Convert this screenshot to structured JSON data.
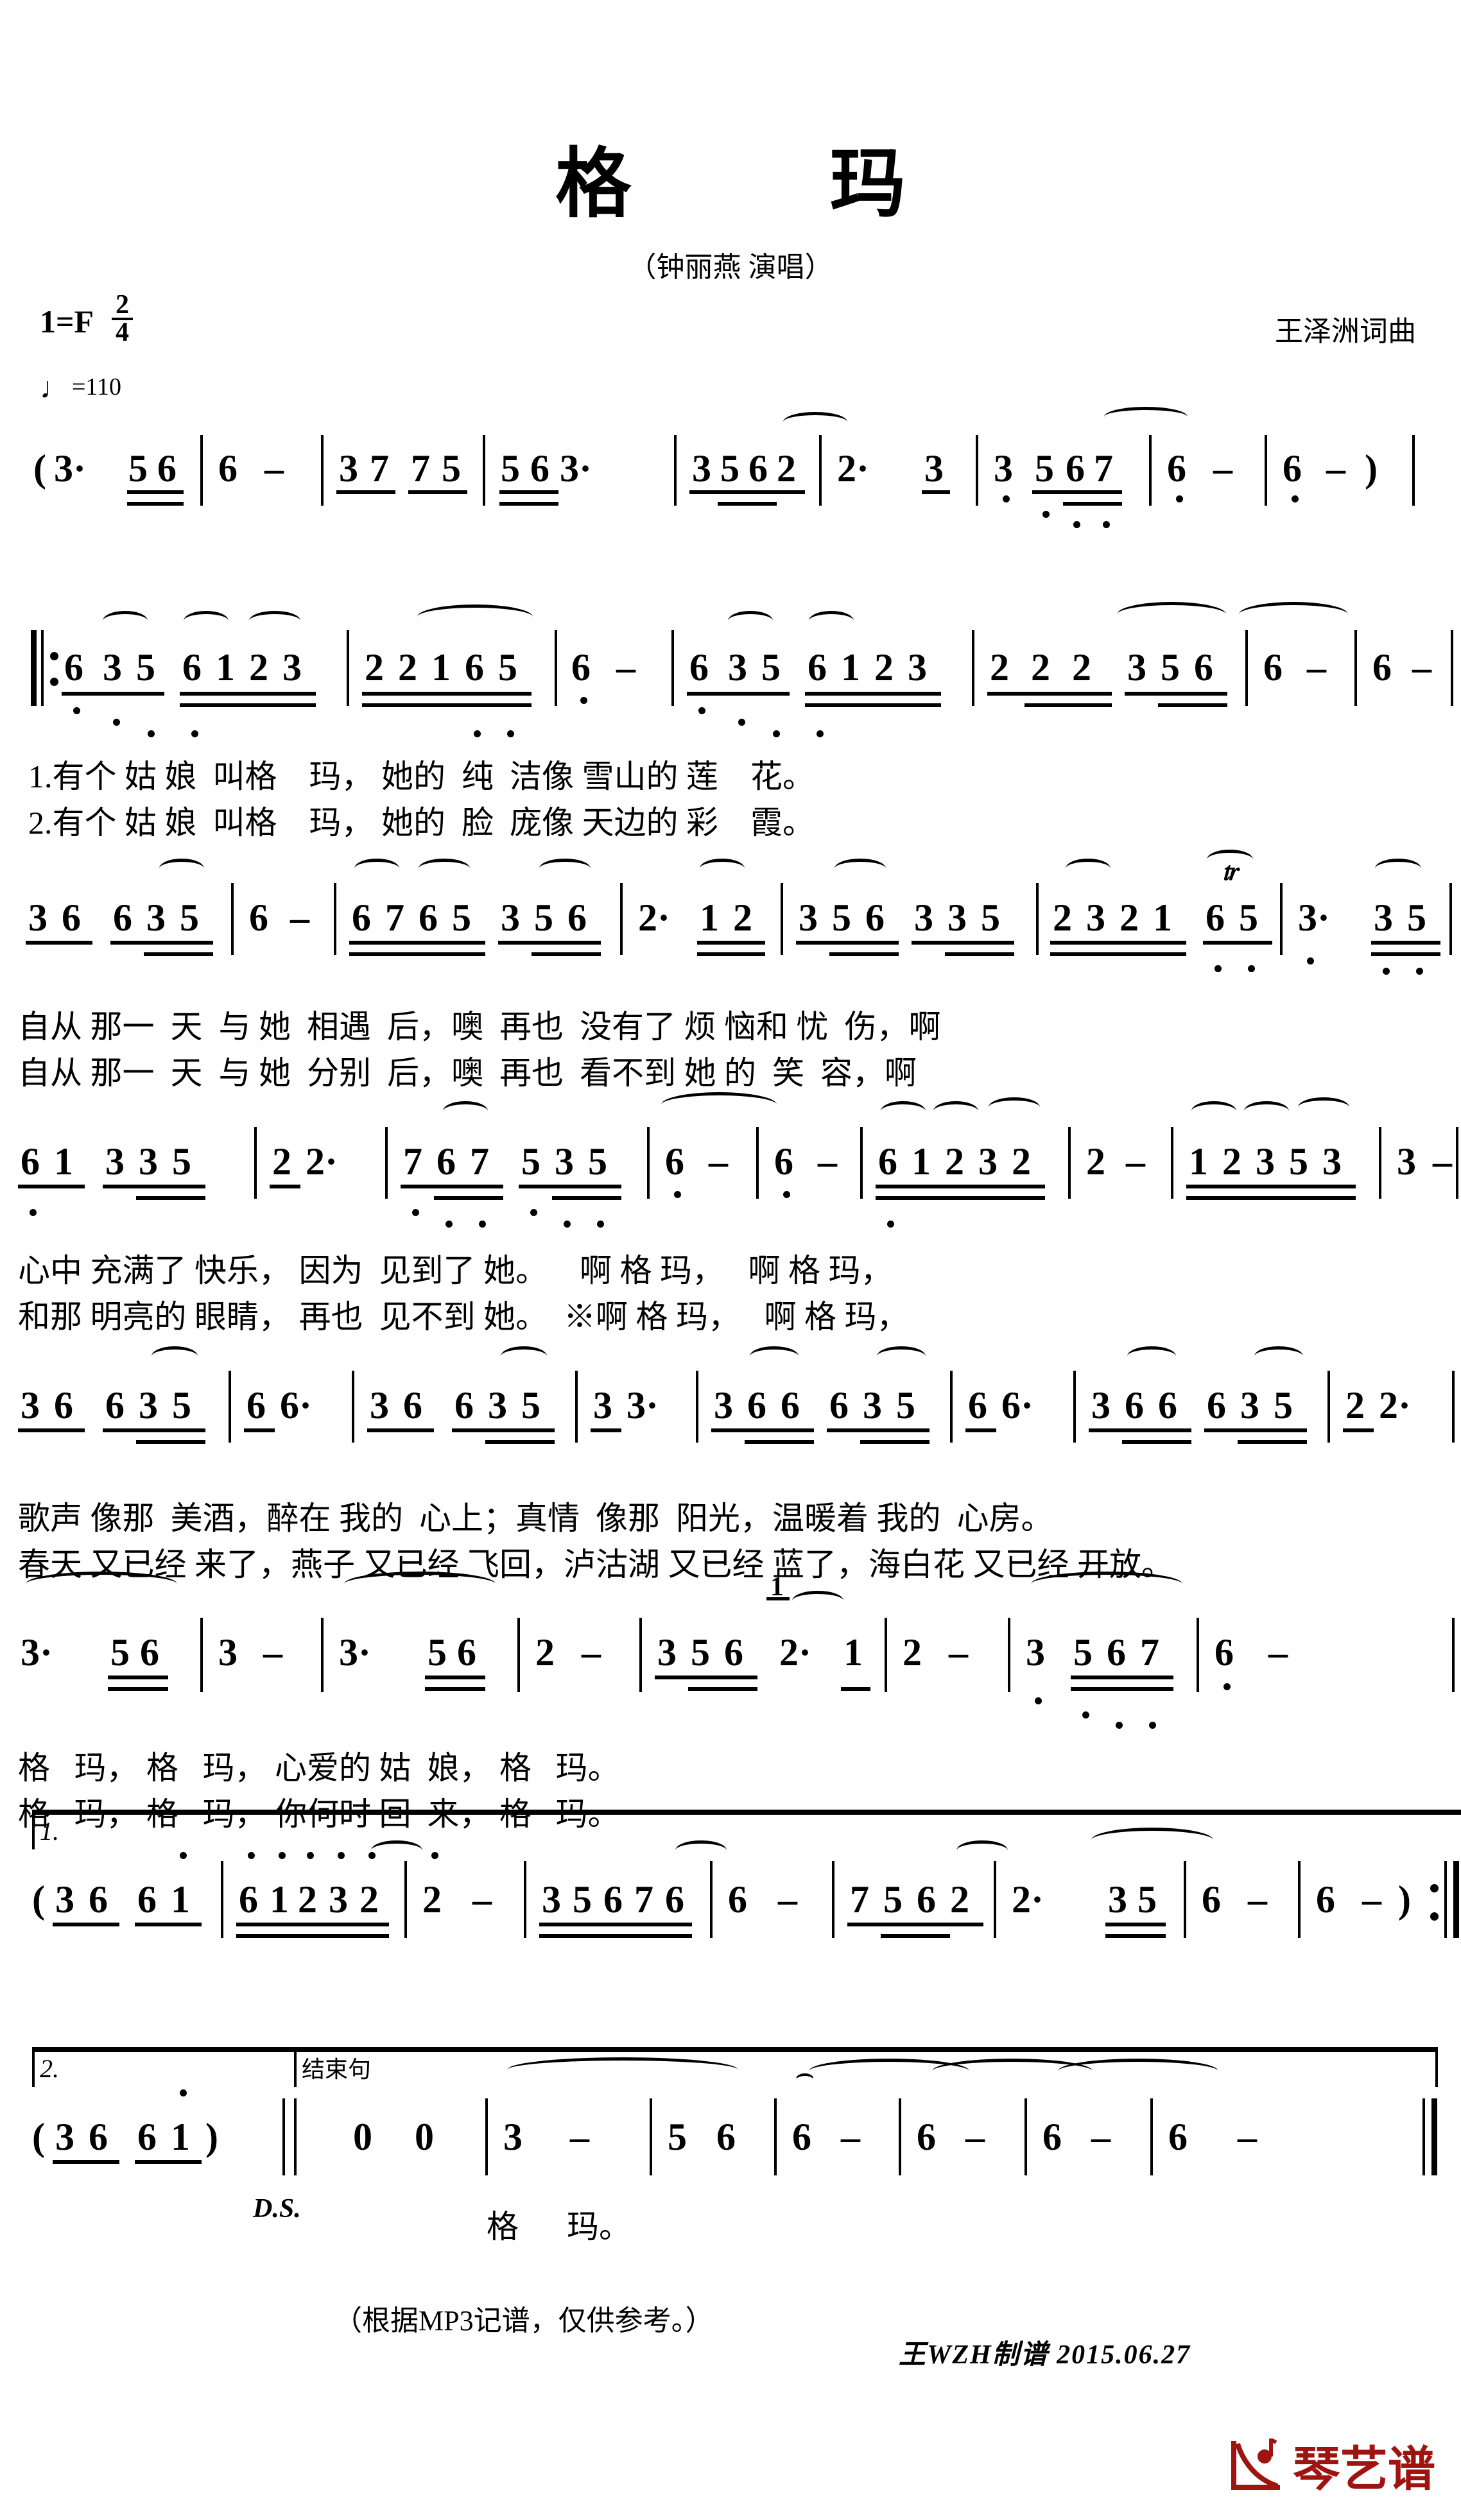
{
  "header": {
    "title": "格玛",
    "title_spaced": "格 玛",
    "singer": "（钟丽燕 演唱）",
    "key_label": "1=F",
    "time_num": "2",
    "time_den": "4",
    "composer": "王泽洲词曲",
    "tempo_label": "=110",
    "tempo_note": "♩"
  },
  "score": {
    "lines": [
      {
        "id": "intro",
        "measures": [
          "(3·  56",
          "6 -",
          "37 75",
          "563·",
          "3562",
          "2·   3",
          "3 567",
          "6 -",
          "6 -)"
        ],
        "notes_text": "(3· 56 | 6 - | 37 75 | 563· | 3562 | 2· 3 | 3 567 | 6 - | 6 -)"
      },
      {
        "id": "verse-line-1",
        "notes_text": "‖: 6 3 5 6 1 2 3 | 2 2 1 6 5 | 6 - | 6 3 5 6 1 2 3 | 2 2 2 3 5 6 | 6 - | 6 -",
        "lyrics1": "1.有个 姑 娘  叫格    玛， 她的  纯  洁像 雪山的 莲    花。",
        "lyrics2": "2.有个 姑 娘  叫格    玛， 她的  脸  庞像 天边的 彩    霞。"
      },
      {
        "id": "verse-line-2",
        "notes_text": "36 635 | 6 - | 6765 356 | 2· 12 | 356 335 | 2321 65 | 3· 35",
        "lyrics1": "自从 那一  天  与 她  相遇  后，噢  再也  没有了 烦 恼和 忧  伤，啊",
        "lyrics2": "自从 那一  天  与 她  分别  后，噢  再也  看不到 她 的  笑  容，啊"
      },
      {
        "id": "verse-line-3",
        "notes_text": "61 335 | 2 2· | 767 535 | 6 - | 6 - | 61232 | 2 - | 12353 | 3 -",
        "lyrics1": "心中 充满了 快乐， 因为  见到了 她。    啊 格 玛，   啊 格 玛，",
        "lyrics2": "和那 明亮的 眼睛， 再也  见不到 她。  ※啊 格 玛，   啊 格 玛，"
      },
      {
        "id": "verse-line-4",
        "notes_text": "36 635 | 66· | 36 635 | 33· | 366 635 | 66· | 366 635 | 22·",
        "lyrics1": "歌声 像那  美酒，醉在 我的  心上；真情  像那  阳光，温暖着 我的  心房。",
        "lyrics2": "春天 又已经 来了，燕子 又已经 飞回，泸沽湖 又已经 蓝了，海白花 又已经 开放。"
      },
      {
        "id": "verse-line-5",
        "notes_text": "3· 56 | 3 - | 3· 56 | 2 - | 356 2· 1 | 2 - | 3 567 | 6 -",
        "lyrics1": "格   玛， 格   玛， 心爱的 姑  娘， 格   玛。",
        "lyrics2": "格   玛， 格   玛， 你何时 回  来， 格   玛。"
      },
      {
        "id": "ending-1",
        "volta": "1.",
        "notes_text": "(36 61 | 61232 | 2 - | 35676 | 6 - | 7562 | 2· 35 | 6 - | 6 -) :‖"
      },
      {
        "id": "ending-2",
        "volta": "2.",
        "coda_label": "结束句",
        "ds_label": "D.S.",
        "notes_text": "(36 61) ‖ 0 0 | 3 - 56 | 6 - | 6 - | 6 - | 6 - ‖",
        "lyrics1": "格      玛。"
      }
    ]
  },
  "footer": {
    "note": "（根据MP3记谱，仅供参考。）",
    "signature": "王WZH制谱 2015.06.27",
    "logo_text": "琴艺谱",
    "logo_color": "#9e1410"
  }
}
